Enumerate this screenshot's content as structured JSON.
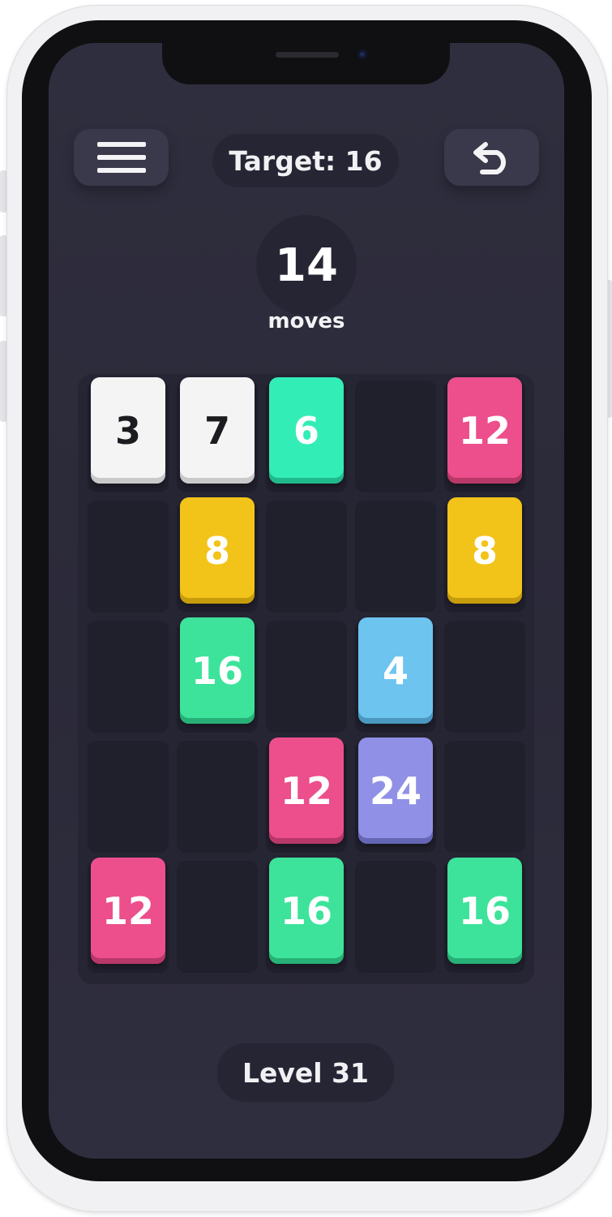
{
  "header": {
    "target_text": "Target: 16",
    "menu_icon": "hamburger-menu-icon",
    "undo_icon": "undo-arrow-icon"
  },
  "moves": {
    "count": "14",
    "label": "moves"
  },
  "footer": {
    "level_text": "Level 31"
  },
  "colors": {
    "screen_bg": "#2d2c3c",
    "board_bg": "#262534",
    "empty_cell": "#201f2c",
    "white_tile": "#f4f4f4",
    "green_tile": "#3de39a",
    "teal_tile": "#33edb6",
    "yellow_tile": "#f2c41a",
    "pink_tile": "#ec4f8c",
    "blue_tile": "#6dc4ef",
    "purple_tile": "#8f90e6"
  },
  "board": {
    "rows": 5,
    "cols": 5,
    "tiles": [
      {
        "row": 0,
        "col": 0,
        "value": "3",
        "color": "#f4f4f4",
        "shadow": "#c9c9cc",
        "text": "#1b1b20"
      },
      {
        "row": 0,
        "col": 1,
        "value": "7",
        "color": "#f4f4f4",
        "shadow": "#c9c9cc",
        "text": "#1b1b20"
      },
      {
        "row": 0,
        "col": 2,
        "value": "6",
        "color": "#33edb6",
        "shadow": "#20b98b",
        "text": "#ffffff"
      },
      {
        "row": 0,
        "col": 4,
        "value": "12",
        "color": "#ec4f8c",
        "shadow": "#b83868",
        "text": "#ffffff"
      },
      {
        "row": 1,
        "col": 1,
        "value": "8",
        "color": "#f2c41a",
        "shadow": "#c79c0c",
        "text": "#ffffff"
      },
      {
        "row": 1,
        "col": 4,
        "value": "8",
        "color": "#f2c41a",
        "shadow": "#c79c0c",
        "text": "#ffffff"
      },
      {
        "row": 2,
        "col": 1,
        "value": "16",
        "color": "#3de39a",
        "shadow": "#27b076",
        "text": "#ffffff"
      },
      {
        "row": 2,
        "col": 3,
        "value": "4",
        "color": "#6dc4ef",
        "shadow": "#4a97c0",
        "text": "#ffffff"
      },
      {
        "row": 3,
        "col": 2,
        "value": "12",
        "color": "#ec4f8c",
        "shadow": "#b83868",
        "text": "#ffffff"
      },
      {
        "row": 3,
        "col": 3,
        "value": "24",
        "color": "#8f90e6",
        "shadow": "#6566b4",
        "text": "#ffffff"
      },
      {
        "row": 4,
        "col": 0,
        "value": "12",
        "color": "#ec4f8c",
        "shadow": "#b83868",
        "text": "#ffffff"
      },
      {
        "row": 4,
        "col": 2,
        "value": "16",
        "color": "#3de39a",
        "shadow": "#27b076",
        "text": "#ffffff"
      },
      {
        "row": 4,
        "col": 4,
        "value": "16",
        "color": "#3de39a",
        "shadow": "#27b076",
        "text": "#ffffff"
      }
    ]
  }
}
